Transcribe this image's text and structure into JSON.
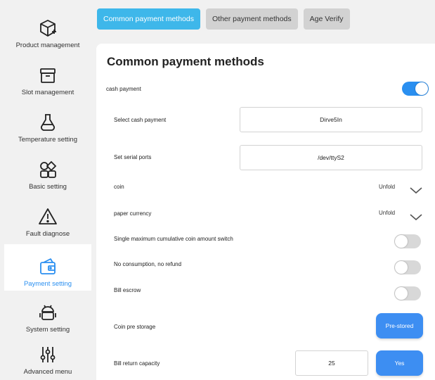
{
  "sidebar": {
    "items": [
      {
        "label": "Product management",
        "icon": "package-plus-icon"
      },
      {
        "label": "Slot management",
        "icon": "archive-box-icon"
      },
      {
        "label": "Temperature setting",
        "icon": "flask-icon"
      },
      {
        "label": "Basic setting",
        "icon": "shapes-grid-icon"
      },
      {
        "label": "Fault diagnose",
        "icon": "warning-triangle-icon"
      },
      {
        "label": "Payment setting",
        "icon": "wallet-icon"
      },
      {
        "label": "System setting",
        "icon": "android-icon"
      },
      {
        "label": "Advanced menu",
        "icon": "sliders-icon"
      }
    ],
    "active_index": 5
  },
  "tabs": [
    {
      "label": "Common payment methods",
      "active": true
    },
    {
      "label": "Other payment methods",
      "active": false
    },
    {
      "label": "Age Verify",
      "active": false
    }
  ],
  "main": {
    "title": "Common payment methods",
    "cash_payment": {
      "label": "cash payment",
      "enabled": true
    },
    "select_cash": {
      "label": "Select cash payment",
      "value": "Dirve5In"
    },
    "serial_ports": {
      "label": "Set serial ports",
      "value": "/dev/ttyS2"
    },
    "coin": {
      "label": "coin",
      "action": "Unfold"
    },
    "paper_currency": {
      "label": "paper currency",
      "action": "Unfold"
    },
    "single_max_switch": {
      "label": "Single maximum cumulative coin amount switch",
      "enabled": false
    },
    "no_consumption": {
      "label": "No consumption, no refund",
      "enabled": false
    },
    "bill_escrow": {
      "label": "Bill escrow",
      "enabled": false
    },
    "coin_pre_storage": {
      "label": "Coin pre storage",
      "button": "Pre-stored"
    },
    "bill_return": {
      "label": "Bill return capacity",
      "value": "25",
      "button": "Yes"
    }
  },
  "colors": {
    "accent": "#2a8ff0",
    "tab_active": "#3eb7ea",
    "button": "#3d8ef2",
    "toggle_off": "#d8d8d8"
  }
}
